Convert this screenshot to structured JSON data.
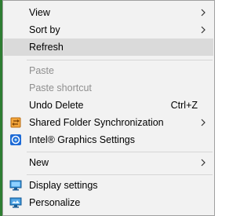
{
  "menu": {
    "items": [
      {
        "label": "View",
        "icon": null,
        "submenu": true
      },
      {
        "label": "Sort by",
        "icon": null,
        "submenu": true
      },
      {
        "label": "Refresh",
        "icon": null,
        "highlighted": true
      },
      {
        "label": "Paste",
        "disabled": true
      },
      {
        "label": "Paste shortcut",
        "disabled": true
      },
      {
        "label": "Undo Delete",
        "shortcut": "Ctrl+Z"
      },
      {
        "label": "Shared Folder Synchronization",
        "icon": "sync-folder-icon",
        "submenu": true
      },
      {
        "label": "Intel® Graphics Settings",
        "icon": "intel-graphics-icon"
      },
      {
        "label": "New",
        "submenu": true
      },
      {
        "label": "Display settings",
        "icon": "display-icon"
      },
      {
        "label": "Personalize",
        "icon": "personalize-icon"
      }
    ]
  },
  "colors": {
    "menu_bg": "#f2f2f2",
    "highlight_bg": "#dadada",
    "disabled_text": "#8f8f8f",
    "border": "#a0a0a0",
    "desktop_edge": "#2e7d32"
  }
}
